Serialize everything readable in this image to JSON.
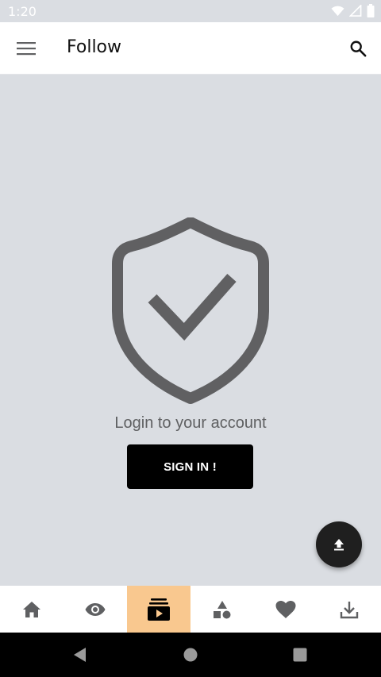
{
  "status_bar": {
    "time": "1:20",
    "icons": [
      "wifi-icon",
      "signal-icon",
      "battery-icon"
    ]
  },
  "app_bar": {
    "title": "Follow",
    "left_icon": "menu-icon",
    "right_icon": "search-icon"
  },
  "main": {
    "illustration": "shield-check-icon",
    "message": "Login to your account",
    "signin_label": "SIGN IN !"
  },
  "fab": {
    "icon": "upload-icon"
  },
  "bottom_nav": {
    "items": [
      {
        "icon": "home-icon",
        "active": false
      },
      {
        "icon": "eye-icon",
        "active": false
      },
      {
        "icon": "subscriptions-icon",
        "active": true
      },
      {
        "icon": "category-icon",
        "active": false
      },
      {
        "icon": "heart-icon",
        "active": false
      },
      {
        "icon": "download-icon",
        "active": false
      }
    ],
    "active_color": "#f9c88f"
  },
  "system_nav": {
    "icons": [
      "back-icon",
      "home-circle-icon",
      "recents-icon"
    ]
  },
  "colors": {
    "background": "#dadde2",
    "app_bar": "#ffffff",
    "button": "#000000",
    "icon": "#5f6062"
  }
}
